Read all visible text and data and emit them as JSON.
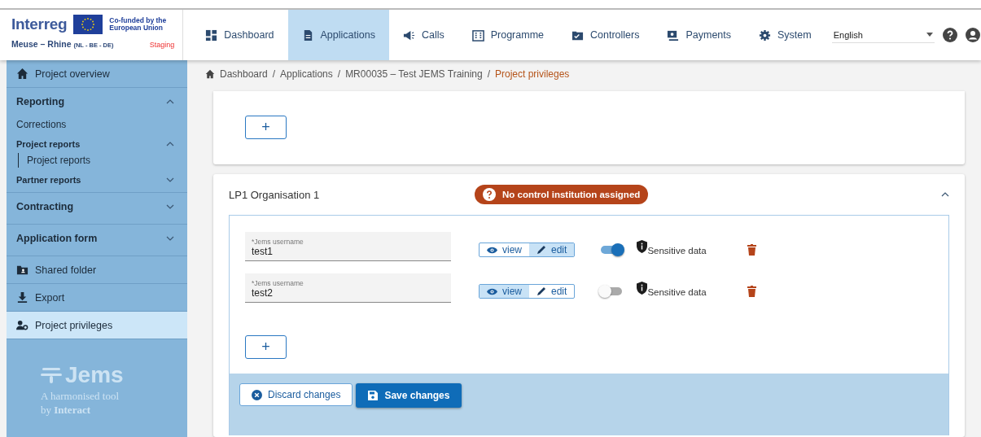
{
  "header": {
    "brand": "Interreg",
    "cofunded": "Co-funded by the European Union",
    "region": "Meuse – Rhine",
    "region_note": "(NL - BE - DE)",
    "environment": "Staging"
  },
  "nav": [
    {
      "label": "Dashboard",
      "selected": false
    },
    {
      "label": "Applications",
      "selected": true
    },
    {
      "label": "Calls",
      "selected": false
    },
    {
      "label": "Programme",
      "selected": false
    },
    {
      "label": "Controllers",
      "selected": false
    },
    {
      "label": "Payments",
      "selected": false
    },
    {
      "label": "System",
      "selected": false
    }
  ],
  "language": "English",
  "sidebar": [
    {
      "kind": "link",
      "label": "Project overview",
      "selected": false
    },
    {
      "kind": "section",
      "label": "Reporting",
      "expanded": true,
      "children": [
        {
          "kind": "plain",
          "label": "Corrections"
        },
        {
          "kind": "group",
          "label": "Project reports",
          "expanded": true,
          "children": [
            {
              "kind": "sub",
              "label": "Project reports"
            }
          ]
        },
        {
          "kind": "group",
          "label": "Partner reports",
          "expanded": false
        }
      ]
    },
    {
      "kind": "section",
      "label": "Contracting",
      "expanded": false
    },
    {
      "kind": "section",
      "label": "Application form",
      "expanded": false
    },
    {
      "kind": "link",
      "label": "Shared folder",
      "selected": false
    },
    {
      "kind": "link",
      "label": "Export",
      "selected": false
    },
    {
      "kind": "link",
      "label": "Project privileges",
      "selected": true
    }
  ],
  "tagline": {
    "name": "Jems",
    "line1": "A harmonised tool",
    "line2_prefix": "by",
    "line2_name": "Interact"
  },
  "breadcrumb": [
    {
      "label": "Dashboard",
      "current": false
    },
    {
      "separator": "/",
      "label": "Applications",
      "current": false
    },
    {
      "separator": "/",
      "label": "MR00035 – Test JEMS Training",
      "current": false
    },
    {
      "separator": "/",
      "label": "Project privileges",
      "current": true
    }
  ],
  "add_button": "+",
  "partner": {
    "title": "LP1 Organisation 1",
    "badge": "No control institution assigned",
    "expanded": true,
    "users": [
      {
        "label": "Jems username",
        "required_mark": "*",
        "value": "test1",
        "permissions": [
          {
            "label": "view",
            "selected": false
          },
          {
            "label": "edit",
            "selected": true
          }
        ],
        "sensitive_label": "Sensitive data",
        "sensitive": true
      },
      {
        "label": "Jems username",
        "required_mark": "*",
        "value": "test2",
        "permissions": [
          {
            "label": "view",
            "selected": true
          },
          {
            "label": "edit",
            "selected": false
          }
        ],
        "sensitive_label": "Sensitive data",
        "sensitive": false
      }
    ],
    "add_button": "+",
    "discard": "Discard changes",
    "save": "Save changes"
  }
}
